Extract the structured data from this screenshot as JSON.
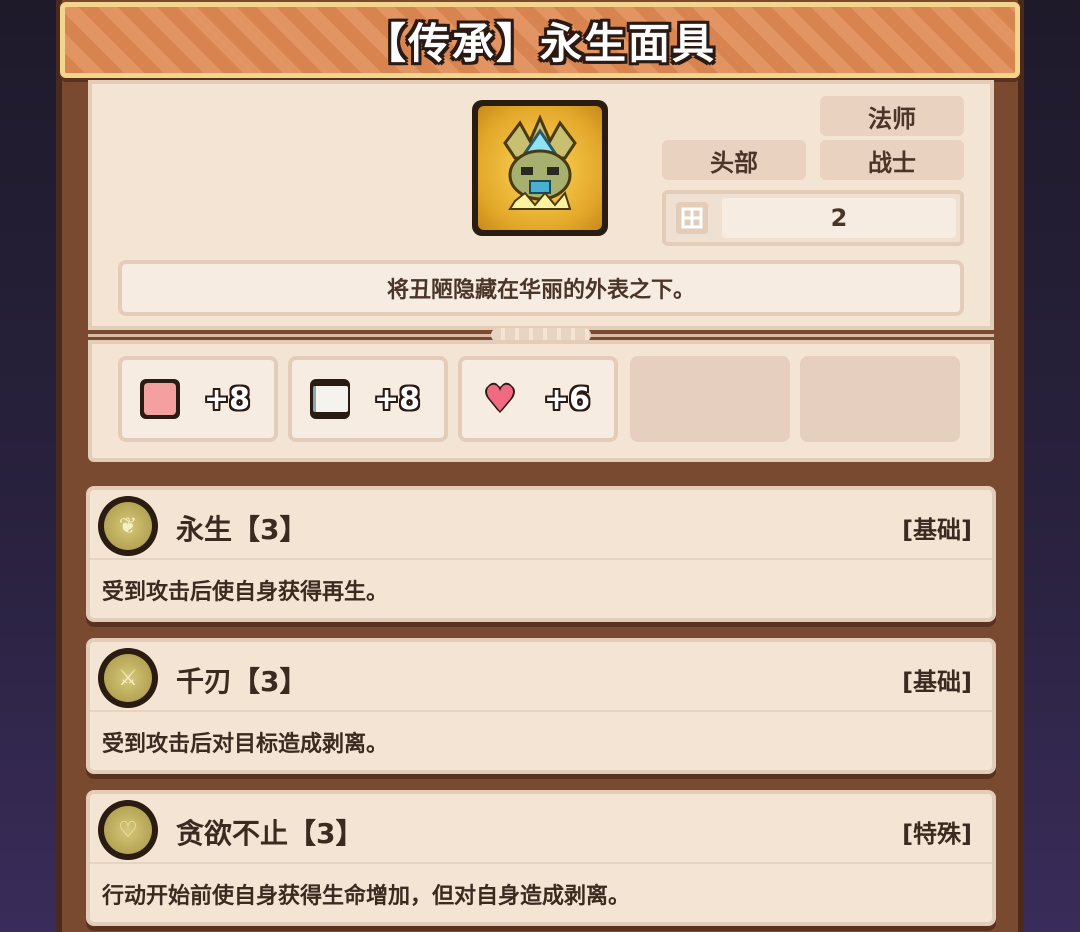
{
  "title": "【传承】永生面具",
  "item": {
    "icon": "golden-crowned-mask-icon",
    "tags": {
      "slot": "头部",
      "class_1": "法师",
      "class_2": "战士"
    },
    "stack_count": "2",
    "description": "将丑陋隐藏在华丽的外表之下。"
  },
  "stats": [
    {
      "icon": "fist-icon",
      "value": "+8"
    },
    {
      "icon": "book-icon",
      "value": "+8"
    },
    {
      "icon": "heart-icon",
      "value": "+6"
    }
  ],
  "skills": [
    {
      "icon": "regeneration-skill-icon",
      "name": "永生【3】",
      "type": "[基础]",
      "description": "受到攻击后使自身获得再生。"
    },
    {
      "icon": "blades-skill-icon",
      "name": "千刃【3】",
      "type": "[基础]",
      "description": "受到攻击后对目标造成剥离。"
    },
    {
      "icon": "heart-skill-icon",
      "name": "贪欲不止【3】",
      "type": "[特殊]",
      "description": "行动开始前使自身获得生命增加，但对自身造成剥离。"
    }
  ],
  "colors": {
    "title_bar": "#d88450",
    "card_bg": "#f3e4d4",
    "frame": "#7a4a30",
    "skill_icon": "#b4a455"
  }
}
